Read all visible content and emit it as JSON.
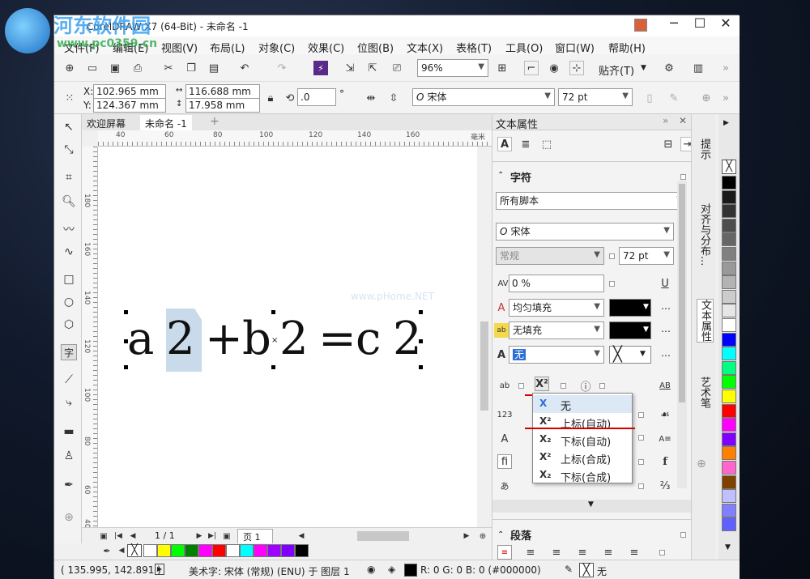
{
  "watermark": {
    "line1": "河东软件园",
    "line2": "www.pc0359.cn"
  },
  "titlebar": {
    "title": "CorelDRAW X7 (64-Bit) - 未命名 -1"
  },
  "menu": [
    "文件(F)",
    "编辑(E)",
    "视图(V)",
    "布局(L)",
    "对象(C)",
    "效果(C)",
    "位图(B)",
    "文本(X)",
    "表格(T)",
    "工具(O)",
    "窗口(W)",
    "帮助(H)"
  ],
  "toolbar": {
    "zoom": "96%",
    "snap_label": "贴齐(T)"
  },
  "propbar": {
    "x": "102.965 mm",
    "y": "124.367 mm",
    "w": "116.688 mm",
    "h": "17.958 mm",
    "angle": ".0",
    "angle_unit": "°",
    "font": "宋体",
    "size": "72 pt"
  },
  "doctabs": {
    "welcome": "欢迎屏幕",
    "doc": "未命名 -1",
    "add": "+"
  },
  "ruler": {
    "top_labels": [
      "40",
      "60",
      "80",
      "100",
      "120",
      "140",
      "160"
    ],
    "unit": "毫米",
    "left_labels": [
      "180",
      "160",
      "140",
      "120",
      "100",
      "80",
      "60",
      "40"
    ]
  },
  "canvas": {
    "chars": [
      "a",
      "2",
      "+",
      "b",
      "2",
      "=",
      "c",
      "2"
    ],
    "watermark_text": "www.pHome.NET"
  },
  "pagebar": {
    "page_count": "1 / 1",
    "page_tab": "页 1"
  },
  "dock": {
    "title": "文本属性",
    "section_char": "字符",
    "script": "所有脚本",
    "font": "宋体",
    "style": "常规",
    "size": "72 pt",
    "kerning": "0 %",
    "fill": "均匀填充",
    "bg_fill": "无填充",
    "outline": "无",
    "fill_color": "#000000",
    "bg_color": "#000000",
    "section_para": "段落"
  },
  "dropdown": {
    "items": [
      {
        "icon": "X",
        "label": "无"
      },
      {
        "icon": "X²",
        "label": "上标(自动)"
      },
      {
        "icon": "X₂",
        "label": "下标(自动)"
      },
      {
        "icon": "X²",
        "label": "上标(合成)"
      },
      {
        "icon": "X₂",
        "label": "下标(合成)"
      }
    ]
  },
  "sidetabs": [
    "提示",
    "对齐与分布...",
    "文本属性",
    "艺术笔"
  ],
  "palette_colors": [
    "#ffffff",
    "#ffff00",
    "#00ff00",
    "#008000",
    "#ff00ff",
    "#ff0000",
    "#ffffff",
    "#00ffff",
    "#ff00ff",
    "#a000ff",
    "#8000ff",
    "#000000"
  ],
  "vpalette_colors": [
    "#000000",
    "#1a1a1a",
    "#333333",
    "#4d4d4d",
    "#666666",
    "#808080",
    "#999999",
    "#b3b3b3",
    "#cccccc",
    "#e6e6e6",
    "#ffffff",
    "#0000ff",
    "#00ffff",
    "#00ff80",
    "#00ff00",
    "#ffff00",
    "#ff0000",
    "#ff00ff",
    "#8000ff",
    "#ff8000",
    "#ff66cc",
    "#804000",
    "#c0c0ff",
    "#8080ff",
    "#6060ff"
  ],
  "status": {
    "coords": "( 135.995, 142.891 )",
    "info": "美术字: 宋体 (常规) (ENU) 于 图层 1",
    "color": "R: 0 G: 0 B: 0 (#000000)",
    "outline": "无",
    "fill_swatch": "#000000"
  }
}
